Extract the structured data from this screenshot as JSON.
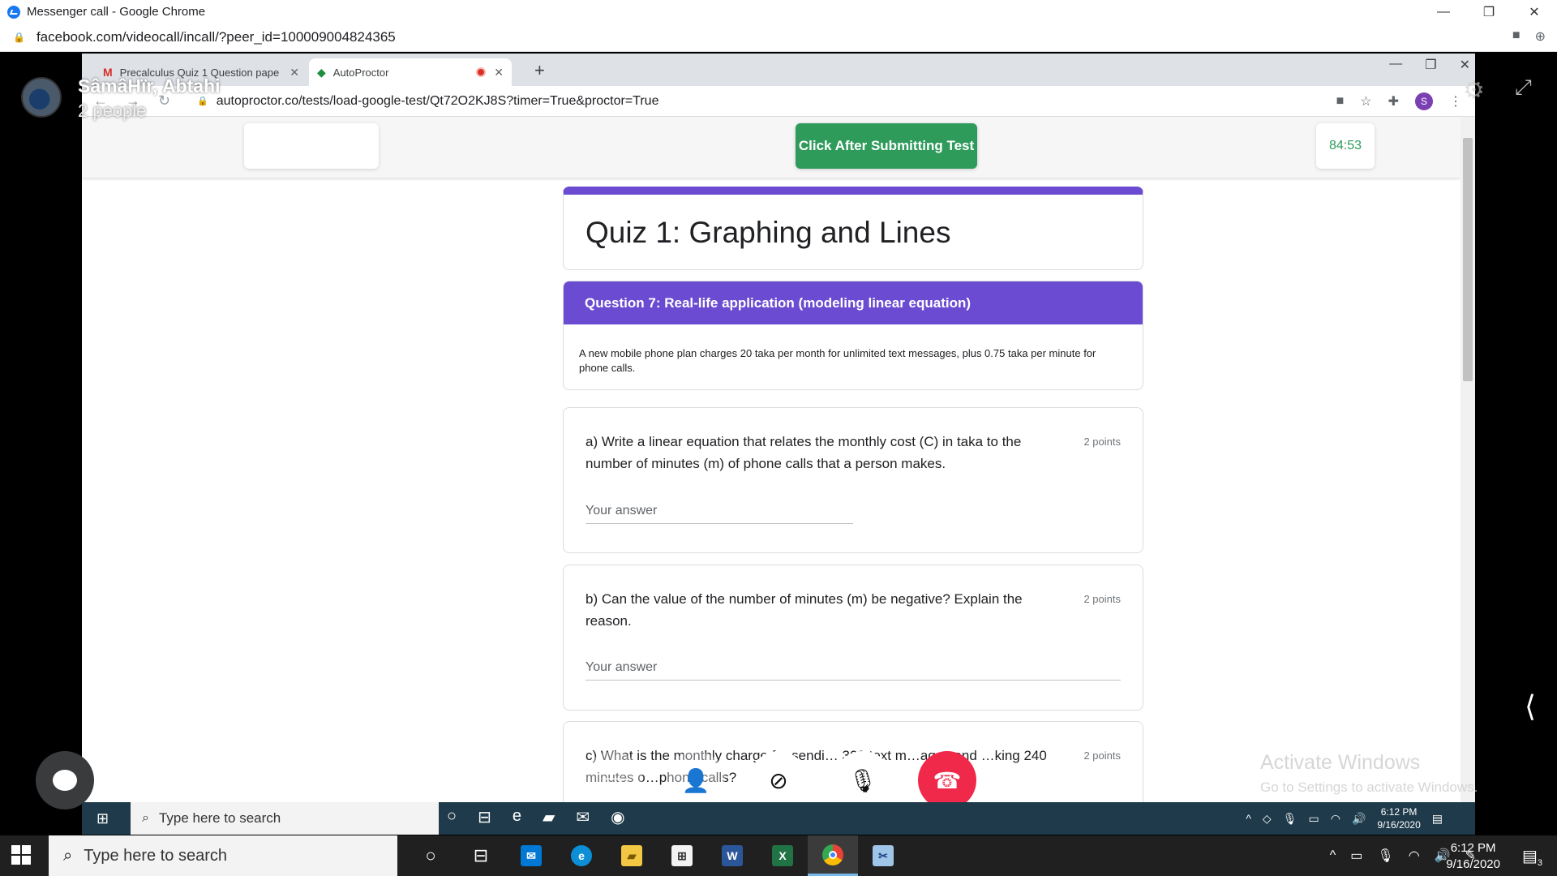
{
  "outer_window": {
    "title": "Messenger call - Google Chrome",
    "url": "facebook.com/videocall/incall/?peer_id=100009004824365",
    "buttons": {
      "minimize": "—",
      "maximize": "❐",
      "close": "✕"
    }
  },
  "inner_browser": {
    "tabs": [
      {
        "label": "Precalculus Quiz 1 Question pape",
        "icon": "gmail-icon"
      },
      {
        "label": "AutoProctor",
        "icon": "autoproctor-icon"
      }
    ],
    "url": "autoproctor.co/tests/load-google-test/Qt72O2KJ8S?timer=True&proctor=True",
    "profile_initial": "S"
  },
  "autoproctor": {
    "submit_button": "Click After Submitting Test",
    "timer": "84:53"
  },
  "form": {
    "title": "Quiz 1: Graphing and Lines",
    "section_title": "Question 7: Real-life application (modeling linear equation)",
    "section_description": "A new mobile phone plan charges 20 taka per month for unlimited text messages, plus 0.75 taka per minute for phone calls.",
    "questions": [
      {
        "text": "a) Write a linear equation that relates the monthly cost (C) in taka to the number of minutes (m) of phone calls that a person makes.",
        "points": "2 points",
        "placeholder": "Your answer"
      },
      {
        "text": "b) Can the value of the number of minutes (m) be negative? Explain the reason.",
        "points": "2 points",
        "placeholder": "Your answer"
      },
      {
        "text": "c) What is the monthly charge for sendi… 300 text m…ages and …king 240 minutes o…phone calls?",
        "points": "2 points"
      }
    ]
  },
  "call": {
    "caller_name": "SâmâHïr, Abtahi",
    "participants": "2 people"
  },
  "watermark": {
    "line1": "Activate Windows",
    "line2": "Go to Settings to activate Windows."
  },
  "inner_taskbar": {
    "search_placeholder": "Type here to search",
    "time": "6:12 PM",
    "date": "9/16/2020"
  },
  "taskbar": {
    "search_placeholder": "Type here to search",
    "time": "6:12 PM",
    "date": "9/16/2020",
    "notification_count": "3",
    "apps": [
      "cortana-icon",
      "task-view-icon",
      "mail-icon",
      "edge-icon",
      "file-explorer-icon",
      "store-icon",
      "word-icon",
      "excel-icon",
      "chrome-icon",
      "snip-icon"
    ]
  }
}
